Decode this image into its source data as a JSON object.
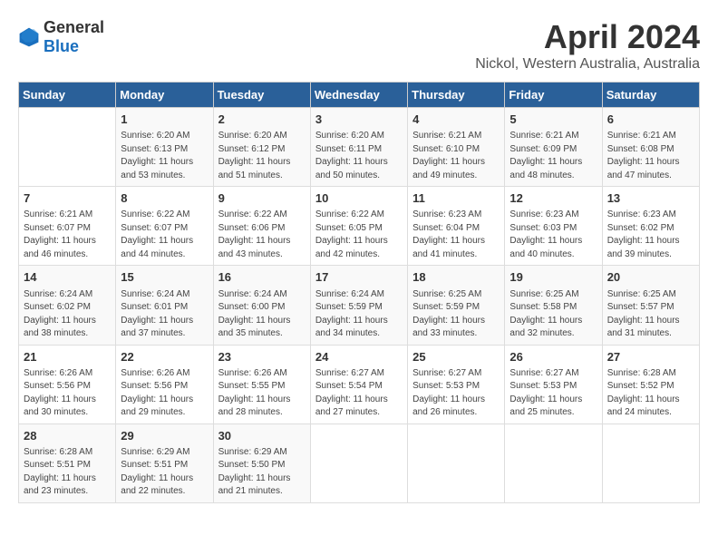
{
  "logo": {
    "general": "General",
    "blue": "Blue"
  },
  "title": "April 2024",
  "location": "Nickol, Western Australia, Australia",
  "weekdays": [
    "Sunday",
    "Monday",
    "Tuesday",
    "Wednesday",
    "Thursday",
    "Friday",
    "Saturday"
  ],
  "weeks": [
    [
      {
        "day": "",
        "info": ""
      },
      {
        "day": "1",
        "info": "Sunrise: 6:20 AM\nSunset: 6:13 PM\nDaylight: 11 hours\nand 53 minutes."
      },
      {
        "day": "2",
        "info": "Sunrise: 6:20 AM\nSunset: 6:12 PM\nDaylight: 11 hours\nand 51 minutes."
      },
      {
        "day": "3",
        "info": "Sunrise: 6:20 AM\nSunset: 6:11 PM\nDaylight: 11 hours\nand 50 minutes."
      },
      {
        "day": "4",
        "info": "Sunrise: 6:21 AM\nSunset: 6:10 PM\nDaylight: 11 hours\nand 49 minutes."
      },
      {
        "day": "5",
        "info": "Sunrise: 6:21 AM\nSunset: 6:09 PM\nDaylight: 11 hours\nand 48 minutes."
      },
      {
        "day": "6",
        "info": "Sunrise: 6:21 AM\nSunset: 6:08 PM\nDaylight: 11 hours\nand 47 minutes."
      }
    ],
    [
      {
        "day": "7",
        "info": "Sunrise: 6:21 AM\nSunset: 6:07 PM\nDaylight: 11 hours\nand 46 minutes."
      },
      {
        "day": "8",
        "info": "Sunrise: 6:22 AM\nSunset: 6:07 PM\nDaylight: 11 hours\nand 44 minutes."
      },
      {
        "day": "9",
        "info": "Sunrise: 6:22 AM\nSunset: 6:06 PM\nDaylight: 11 hours\nand 43 minutes."
      },
      {
        "day": "10",
        "info": "Sunrise: 6:22 AM\nSunset: 6:05 PM\nDaylight: 11 hours\nand 42 minutes."
      },
      {
        "day": "11",
        "info": "Sunrise: 6:23 AM\nSunset: 6:04 PM\nDaylight: 11 hours\nand 41 minutes."
      },
      {
        "day": "12",
        "info": "Sunrise: 6:23 AM\nSunset: 6:03 PM\nDaylight: 11 hours\nand 40 minutes."
      },
      {
        "day": "13",
        "info": "Sunrise: 6:23 AM\nSunset: 6:02 PM\nDaylight: 11 hours\nand 39 minutes."
      }
    ],
    [
      {
        "day": "14",
        "info": "Sunrise: 6:24 AM\nSunset: 6:02 PM\nDaylight: 11 hours\nand 38 minutes."
      },
      {
        "day": "15",
        "info": "Sunrise: 6:24 AM\nSunset: 6:01 PM\nDaylight: 11 hours\nand 37 minutes."
      },
      {
        "day": "16",
        "info": "Sunrise: 6:24 AM\nSunset: 6:00 PM\nDaylight: 11 hours\nand 35 minutes."
      },
      {
        "day": "17",
        "info": "Sunrise: 6:24 AM\nSunset: 5:59 PM\nDaylight: 11 hours\nand 34 minutes."
      },
      {
        "day": "18",
        "info": "Sunrise: 6:25 AM\nSunset: 5:59 PM\nDaylight: 11 hours\nand 33 minutes."
      },
      {
        "day": "19",
        "info": "Sunrise: 6:25 AM\nSunset: 5:58 PM\nDaylight: 11 hours\nand 32 minutes."
      },
      {
        "day": "20",
        "info": "Sunrise: 6:25 AM\nSunset: 5:57 PM\nDaylight: 11 hours\nand 31 minutes."
      }
    ],
    [
      {
        "day": "21",
        "info": "Sunrise: 6:26 AM\nSunset: 5:56 PM\nDaylight: 11 hours\nand 30 minutes."
      },
      {
        "day": "22",
        "info": "Sunrise: 6:26 AM\nSunset: 5:56 PM\nDaylight: 11 hours\nand 29 minutes."
      },
      {
        "day": "23",
        "info": "Sunrise: 6:26 AM\nSunset: 5:55 PM\nDaylight: 11 hours\nand 28 minutes."
      },
      {
        "day": "24",
        "info": "Sunrise: 6:27 AM\nSunset: 5:54 PM\nDaylight: 11 hours\nand 27 minutes."
      },
      {
        "day": "25",
        "info": "Sunrise: 6:27 AM\nSunset: 5:53 PM\nDaylight: 11 hours\nand 26 minutes."
      },
      {
        "day": "26",
        "info": "Sunrise: 6:27 AM\nSunset: 5:53 PM\nDaylight: 11 hours\nand 25 minutes."
      },
      {
        "day": "27",
        "info": "Sunrise: 6:28 AM\nSunset: 5:52 PM\nDaylight: 11 hours\nand 24 minutes."
      }
    ],
    [
      {
        "day": "28",
        "info": "Sunrise: 6:28 AM\nSunset: 5:51 PM\nDaylight: 11 hours\nand 23 minutes."
      },
      {
        "day": "29",
        "info": "Sunrise: 6:29 AM\nSunset: 5:51 PM\nDaylight: 11 hours\nand 22 minutes."
      },
      {
        "day": "30",
        "info": "Sunrise: 6:29 AM\nSunset: 5:50 PM\nDaylight: 11 hours\nand 21 minutes."
      },
      {
        "day": "",
        "info": ""
      },
      {
        "day": "",
        "info": ""
      },
      {
        "day": "",
        "info": ""
      },
      {
        "day": "",
        "info": ""
      }
    ]
  ]
}
